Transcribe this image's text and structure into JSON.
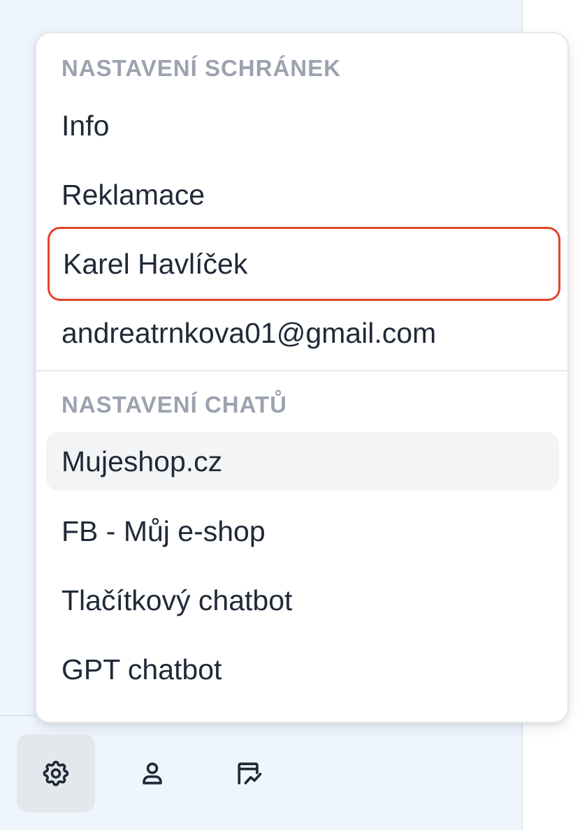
{
  "menu": {
    "mailbox_section": {
      "title": "NASTAVENÍ SCHRÁNEK",
      "items": [
        {
          "label": "Info"
        },
        {
          "label": "Reklamace"
        },
        {
          "label": "Karel Havlíček"
        },
        {
          "label": "andreatrnkova01@gmail.com"
        }
      ]
    },
    "chat_section": {
      "title": "NASTAVENÍ CHATŮ",
      "items": [
        {
          "label": "Mujeshop.cz"
        },
        {
          "label": "FB - Můj e-shop"
        },
        {
          "label": "Tlačítkový chatbot"
        },
        {
          "label": "GPT chatbot"
        }
      ]
    }
  },
  "bottom_nav": {
    "items": [
      {
        "icon": "gear-icon",
        "active": true
      },
      {
        "icon": "user-icon",
        "active": false
      },
      {
        "icon": "chart-icon",
        "active": false
      }
    ]
  },
  "colors": {
    "highlight_border": "#e2432b",
    "section_title": "#9ca3af",
    "item_text": "#1f2937",
    "hover_bg": "#f3f4f6",
    "app_bg": "#eff5fd"
  }
}
